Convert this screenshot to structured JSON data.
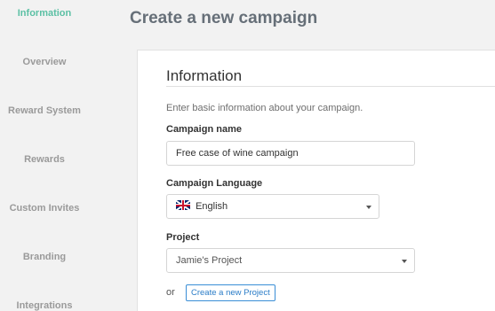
{
  "sidebar": {
    "items": [
      {
        "label": "Information",
        "active": true
      },
      {
        "label": "Overview"
      },
      {
        "label": "Reward System"
      },
      {
        "label": "Rewards"
      },
      {
        "label": "Custom Invites"
      },
      {
        "label": "Branding"
      },
      {
        "label": "Integrations"
      }
    ]
  },
  "page": {
    "title": "Create a new campaign"
  },
  "section": {
    "title": "Information",
    "description": "Enter basic information about your campaign."
  },
  "form": {
    "campaign_name": {
      "label": "Campaign name",
      "value": "Free case of wine campaign"
    },
    "campaign_language": {
      "label": "Campaign Language",
      "value": "English",
      "flag_icon": "uk-flag-icon"
    },
    "project": {
      "label": "Project",
      "value": "Jamie's Project"
    },
    "or_text": "or",
    "create_project_button": "Create a new Project"
  },
  "colors": {
    "accent_active": "#5bc0a4",
    "button_border": "#3a8ed6",
    "page_background": "#f2f2f2"
  }
}
